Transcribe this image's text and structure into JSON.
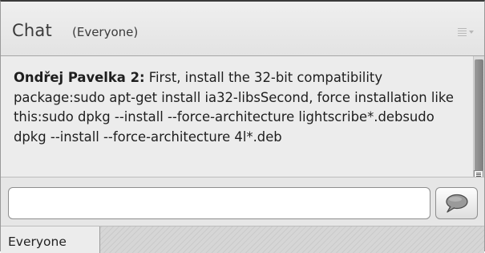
{
  "header": {
    "title": "Chat",
    "audience": "(Everyone)"
  },
  "messages": [
    {
      "sender": "Ondřej Pavelka 2:",
      "text": " First, install the 32-bit compatibility package:sudo apt-get install ia32-libsSecond, force installation like this:sudo dpkg --install --force-architecture lightscribe*.debsudo dpkg --install --force-architecture 4l*.deb"
    }
  ],
  "composer": {
    "input_value": "",
    "input_placeholder": "",
    "send_icon": "speech-bubble-icon"
  },
  "tabs": [
    {
      "label": "Everyone",
      "active": true
    }
  ],
  "icons": {
    "options": "menu-lines-icon"
  }
}
